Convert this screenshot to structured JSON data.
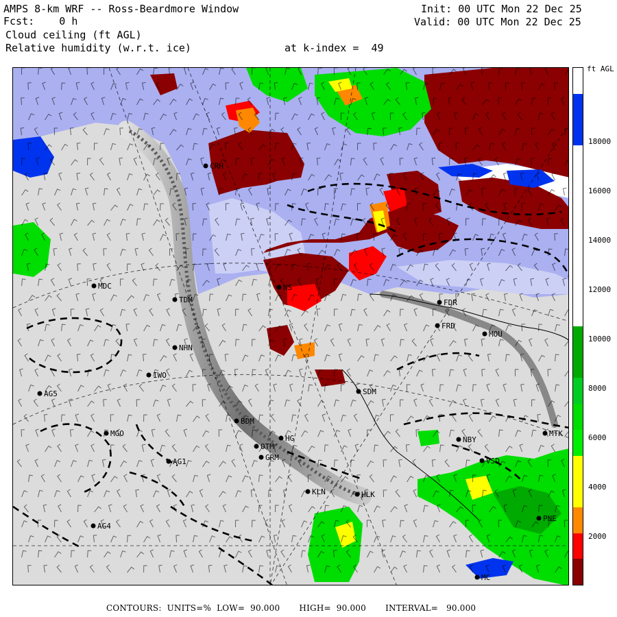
{
  "header": {
    "title": "AMPS 8-km WRF -- Ross-Beardmore Window",
    "fcst_label": "Fcst:",
    "fcst_value": "0 h",
    "field1": "Cloud ceiling (ft AGL)",
    "field2": "Relative humidity (w.r.t. ice)",
    "k_index_label": "at k-index =",
    "k_index_value": "49",
    "init_label": "Init:",
    "init_value": "00 UTC Mon 22 Dec 25",
    "valid_label": "Valid:",
    "valid_value": "00 UTC Mon 22 Dec 25"
  },
  "colorbar": {
    "unit": "ft AGL",
    "ticks": [
      "18000",
      "16000",
      "14000",
      "12000",
      "10000",
      "8000",
      "6000",
      "4000",
      "2000"
    ],
    "colors_top_to_bottom": [
      "#ffffff",
      "#0033ee",
      "#0033ee",
      "#ffffff",
      "#ffffff",
      "#ffffff",
      "#ffffff",
      "#ffffff",
      "#ffffff",
      "#ffffff",
      "#00aa00",
      "#00aa00",
      "#00cc22",
      "#00dd00",
      "#00ee00",
      "#ffff00",
      "#ffff00",
      "#ff8800",
      "#ff0000",
      "#880000"
    ]
  },
  "stations": [
    {
      "code": "CRH"
    },
    {
      "code": "MDC"
    },
    {
      "code": "TDM"
    },
    {
      "code": "NHN"
    },
    {
      "code": "IWO"
    },
    {
      "code": "AG5"
    },
    {
      "code": "MGO"
    },
    {
      "code": "BDM"
    },
    {
      "code": "AG1"
    },
    {
      "code": "OTM"
    },
    {
      "code": "GRM"
    },
    {
      "code": "HG"
    },
    {
      "code": "KLN"
    },
    {
      "code": "HLK"
    },
    {
      "code": "AG4"
    },
    {
      "code": "FDR"
    },
    {
      "code": "FRD"
    },
    {
      "code": "MOU"
    },
    {
      "code": "SDM"
    },
    {
      "code": "NBY"
    },
    {
      "code": "MTK"
    },
    {
      "code": "VSD"
    },
    {
      "code": "PNE"
    },
    {
      "code": "MC"
    },
    {
      "code": "NS"
    }
  ],
  "colors": {
    "cloud_free": "#d8d8d8",
    "lavender": "#aab0f0",
    "pale_lavender": "#ccd0f5",
    "dark_red": "#8b0000",
    "red": "#ff0000",
    "orange": "#ff8800",
    "yellow": "#ffff00",
    "green": "#00dd00",
    "dark_green": "#00aa00",
    "blue": "#0033ee"
  },
  "footer": {
    "contours_label": "CONTOURS:",
    "units_label": "UNITS=%",
    "low_label": "LOW=",
    "low_value": "90.000",
    "high_label": "HIGH=",
    "high_value": "90.000",
    "interval_label": "INTERVAL=",
    "interval_value": "90.000"
  }
}
